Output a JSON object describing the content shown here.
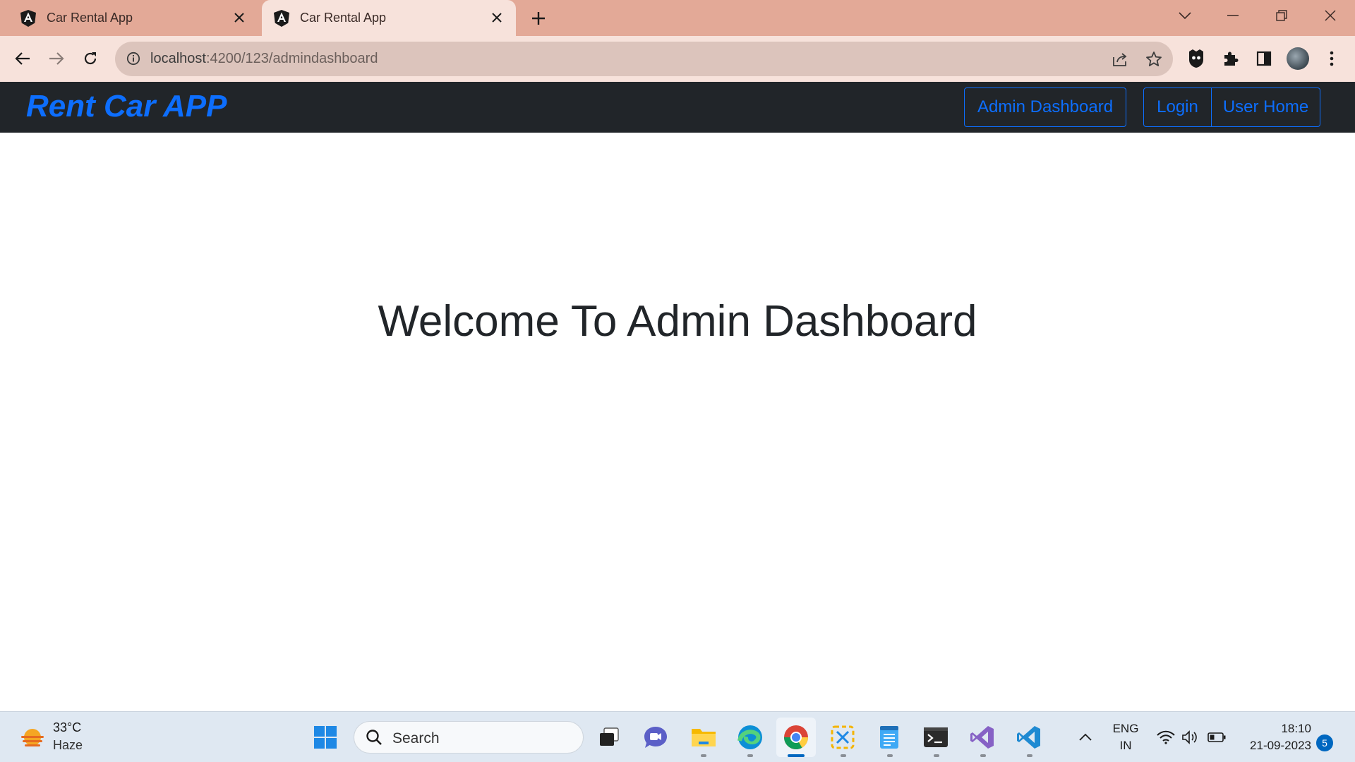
{
  "browser": {
    "tabs": [
      {
        "title": "Car Rental App",
        "active": false
      },
      {
        "title": "Car Rental App",
        "active": true
      }
    ],
    "url_host": "localhost",
    "url_path": ":4200/123/admindashboard"
  },
  "navbar": {
    "brand": "Rent Car APP",
    "admin_button": "Admin Dashboard",
    "login_button": "Login",
    "user_home_button": "User Home",
    "accent_color": "#0d6efd"
  },
  "main": {
    "heading": "Welcome To Admin Dashboard"
  },
  "taskbar": {
    "weather_temp": "33°C",
    "weather_desc": "Haze",
    "search_placeholder": "Search",
    "apps": [
      "windows-start",
      "file-explorer-task-view",
      "teams-chat",
      "file-explorer",
      "edge",
      "chrome",
      "snipping-tool",
      "notepad",
      "terminal",
      "visual-studio",
      "vs-code"
    ],
    "language": "ENG",
    "region": "IN",
    "time": "18:10",
    "date": "21-09-2023",
    "notifications": "5"
  }
}
